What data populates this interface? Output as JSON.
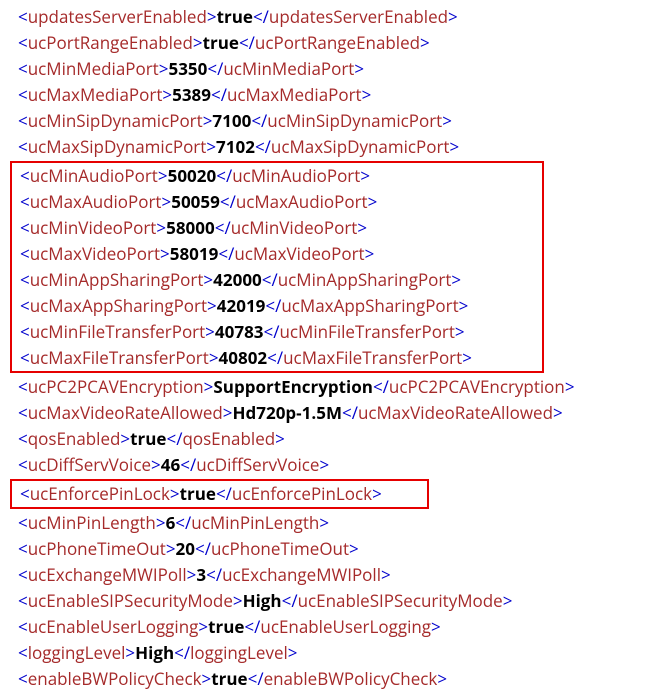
{
  "lines": [
    {
      "tag": "updatesServerEnabled",
      "value": "true"
    },
    {
      "tag": "ucPortRangeEnabled",
      "value": "true"
    },
    {
      "tag": "ucMinMediaPort",
      "value": "5350"
    },
    {
      "tag": "ucMaxMediaPort",
      "value": "5389"
    },
    {
      "tag": "ucMinSipDynamicPort",
      "value": "7100"
    },
    {
      "tag": "ucMaxSipDynamicPort",
      "value": "7102"
    }
  ],
  "box1": [
    {
      "tag": "ucMinAudioPort",
      "value": "50020"
    },
    {
      "tag": "ucMaxAudioPort",
      "value": "50059"
    },
    {
      "tag": "ucMinVideoPort",
      "value": "58000"
    },
    {
      "tag": "ucMaxVideoPort",
      "value": "58019"
    },
    {
      "tag": "ucMinAppSharingPort",
      "value": "42000"
    },
    {
      "tag": "ucMaxAppSharingPort",
      "value": "42019"
    },
    {
      "tag": "ucMinFileTransferPort",
      "value": "40783"
    },
    {
      "tag": "ucMaxFileTransferPort",
      "value": "40802"
    }
  ],
  "mid": [
    {
      "tag": "ucPC2PCAVEncryption",
      "value": "SupportEncryption"
    },
    {
      "tag": "ucMaxVideoRateAllowed",
      "value": "Hd720p-1.5M"
    },
    {
      "tag": "qosEnabled",
      "value": "true"
    },
    {
      "tag": "ucDiffServVoice",
      "value": "46"
    }
  ],
  "box2": [
    {
      "tag": "ucEnforcePinLock",
      "value": "true"
    }
  ],
  "tail": [
    {
      "tag": "ucMinPinLength",
      "value": "6"
    },
    {
      "tag": "ucPhoneTimeOut",
      "value": "20"
    },
    {
      "tag": "ucExchangeMWIPoll",
      "value": "3"
    },
    {
      "tag": "ucEnableSIPSecurityMode",
      "value": "High"
    },
    {
      "tag": "ucEnableUserLogging",
      "value": "true"
    },
    {
      "tag": "loggingLevel",
      "value": "High"
    },
    {
      "tag": "enableBWPolicyCheck",
      "value": "true"
    }
  ]
}
